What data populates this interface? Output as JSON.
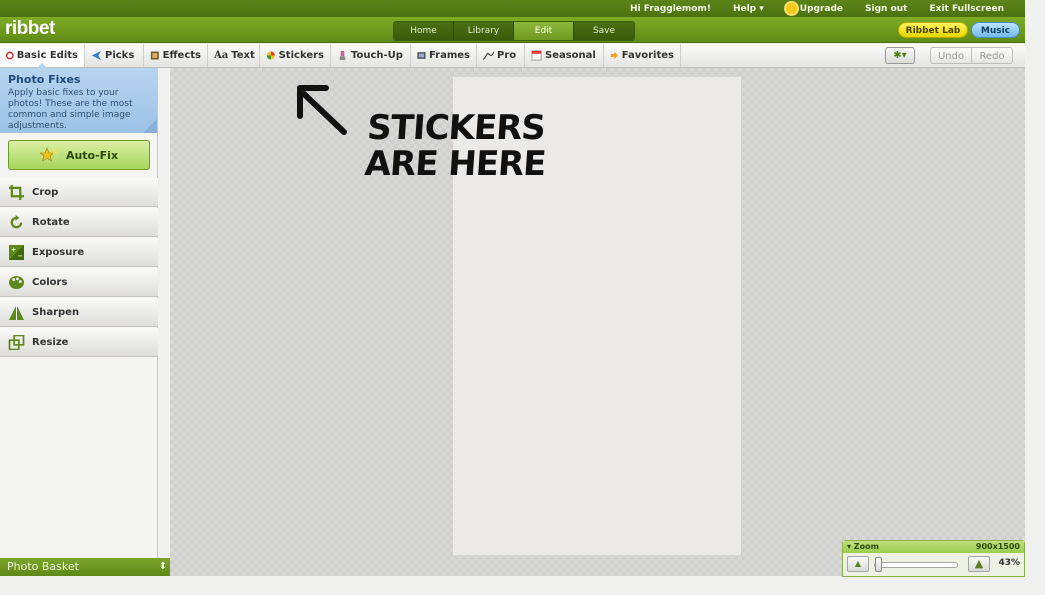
{
  "topbar": {
    "greeting": "Hi Fragglemom!",
    "help": "Help ▾",
    "upgrade": "Upgrade",
    "signout": "Sign out",
    "exit": "Exit Fullscreen"
  },
  "header": {
    "logo": "ribbet",
    "tabs": [
      "Home",
      "Library",
      "Edit",
      "Save"
    ],
    "active_tab": "Edit",
    "ribbet_lab": "Ribbet Lab",
    "music": "Music"
  },
  "toolbar": {
    "items": [
      "Basic Edits",
      "Picks",
      "Effects",
      "Text",
      "Stickers",
      "Touch-Up",
      "Frames",
      "Pro",
      "Seasonal",
      "Favorites"
    ],
    "active": "Basic Edits",
    "undo": "Undo",
    "redo": "Redo"
  },
  "sidebar": {
    "panel_title": "Photo Fixes",
    "panel_desc": "Apply basic fixes to your photos! These are the most common and simple image adjustments.",
    "autofix": "Auto-Fix",
    "items": [
      "Crop",
      "Rotate",
      "Exposure",
      "Colors",
      "Sharpen",
      "Resize"
    ],
    "basket": "Photo Basket"
  },
  "annotation": {
    "line1": "Stickers",
    "line2": "are here"
  },
  "zoom": {
    "label": "▾ Zoom",
    "dimensions": "900x1500",
    "percent": "43%",
    "level": 0.43
  },
  "colors": {
    "brand_green": "#6d9a1f",
    "panel_blue": "#b7d4ef",
    "lab_yellow": "#f5e828",
    "music_blue": "#8cc8f0"
  }
}
